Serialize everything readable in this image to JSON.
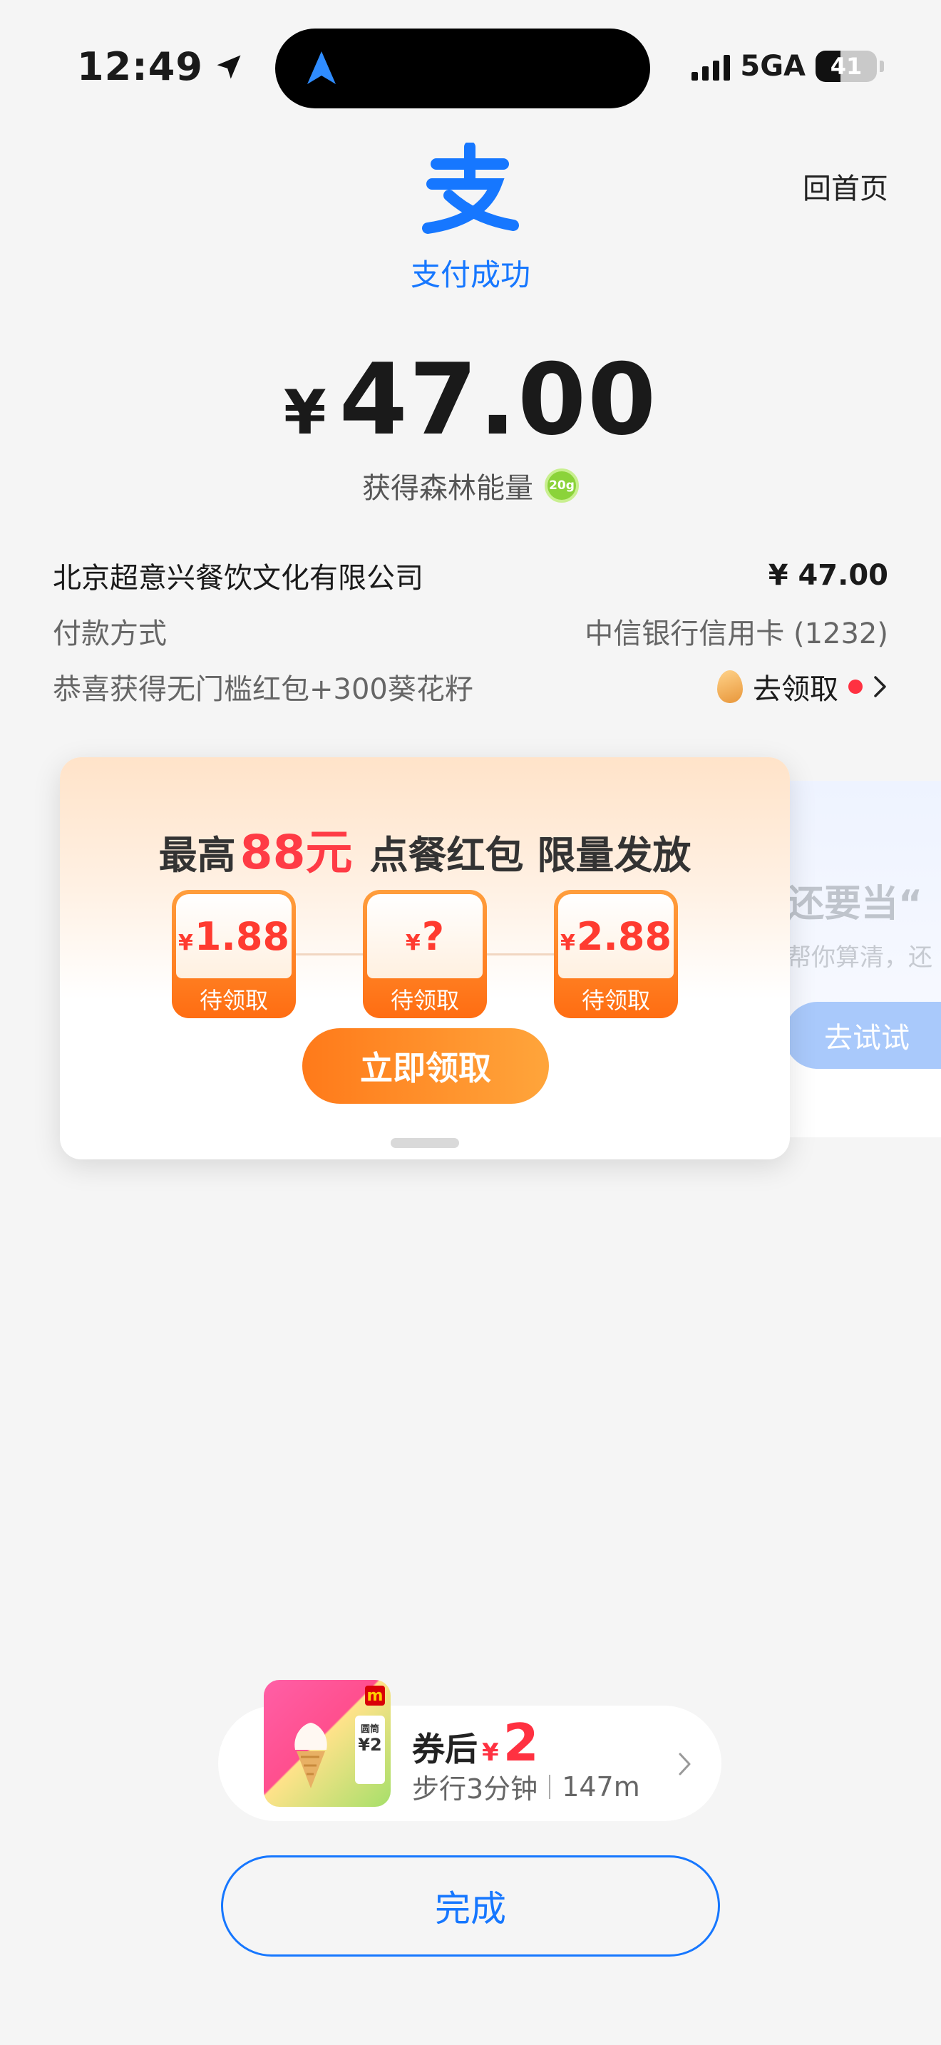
{
  "status_bar": {
    "time": "12:49",
    "network": "5GA",
    "battery": "41",
    "battery_level_percent": 41
  },
  "header": {
    "logo_icon": "alipay-logo-icon",
    "pay_status": "支付成功",
    "home_link": "回首页"
  },
  "payment": {
    "currency_symbol": "¥",
    "amount": "47.00",
    "energy_label": "获得森林能量",
    "energy_badge": "20g"
  },
  "details": {
    "merchant": "北京超意兴餐饮文化有限公司",
    "merchant_amount": "¥ 47.00",
    "method_label": "付款方式",
    "method_value": "中信银行信用卡 (1232)",
    "reward_label": "恭喜获得无门槛红包+300葵花籽",
    "reward_action": "去领取"
  },
  "promo": {
    "title_prefix": "最高",
    "title_highlight": "88元",
    "title_suffix": "点餐红包 限量发放",
    "coupons": [
      {
        "symbol": "¥",
        "amount": "1.88",
        "label": "待领取"
      },
      {
        "symbol": "¥",
        "amount": "?",
        "label": "待领取"
      },
      {
        "symbol": "¥",
        "amount": "2.88",
        "label": "待领取"
      }
    ],
    "claim_button": "立即领取"
  },
  "secondary_card": {
    "title": "还要当“",
    "subtitle": "帮你算清，还",
    "button": "去试试"
  },
  "bottom_coupon": {
    "label": "券后",
    "currency": "¥",
    "price": "2",
    "walk": "步行3分钟",
    "distance": "147m",
    "product_tag_line1": "圆筒",
    "product_tag_line2": "¥2"
  },
  "done_button": "完成",
  "colors": {
    "brand_blue": "#1677ff",
    "accent_red": "#ff3141",
    "promo_orange": "#ff7a1a"
  }
}
